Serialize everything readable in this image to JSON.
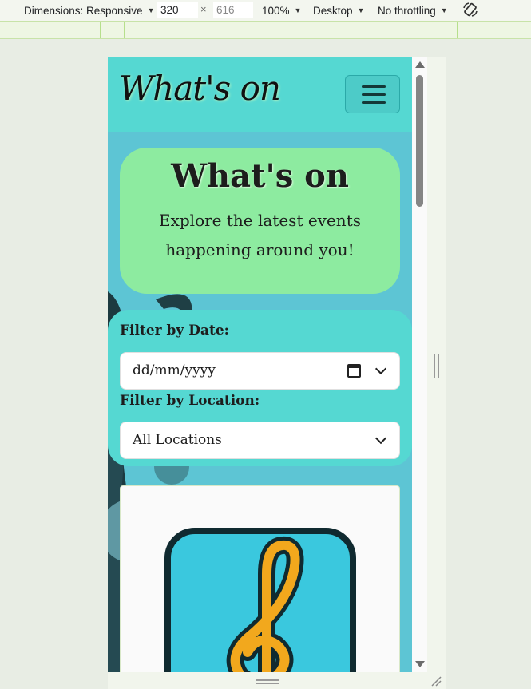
{
  "devtools": {
    "dimensions_label": "Dimensions: Responsive",
    "width_value": "320",
    "height_value": "616",
    "times": "×",
    "zoom": "100%",
    "device_type": "Desktop",
    "throttling": "No throttling"
  },
  "site": {
    "brand": "What's on",
    "hero": {
      "title": "What's on",
      "subtitle": "Explore the latest events happening around you!"
    },
    "filters": {
      "date_label": "Filter by Date:",
      "date_placeholder": "dd/mm/yyyy",
      "location_label": "Filter by Location:",
      "location_selected": "All Locations"
    }
  },
  "colors": {
    "navbar": "#55d8d2",
    "hero": "#8deba0",
    "page_bg": "#5dc5d4",
    "note_tile": "#3ac8de",
    "note_glyph": "#f2a81d"
  },
  "icons": [
    "rotate-icon",
    "hamburger-menu-icon",
    "calendar-icon",
    "chevron-down-icon",
    "treble-clef-icon"
  ]
}
